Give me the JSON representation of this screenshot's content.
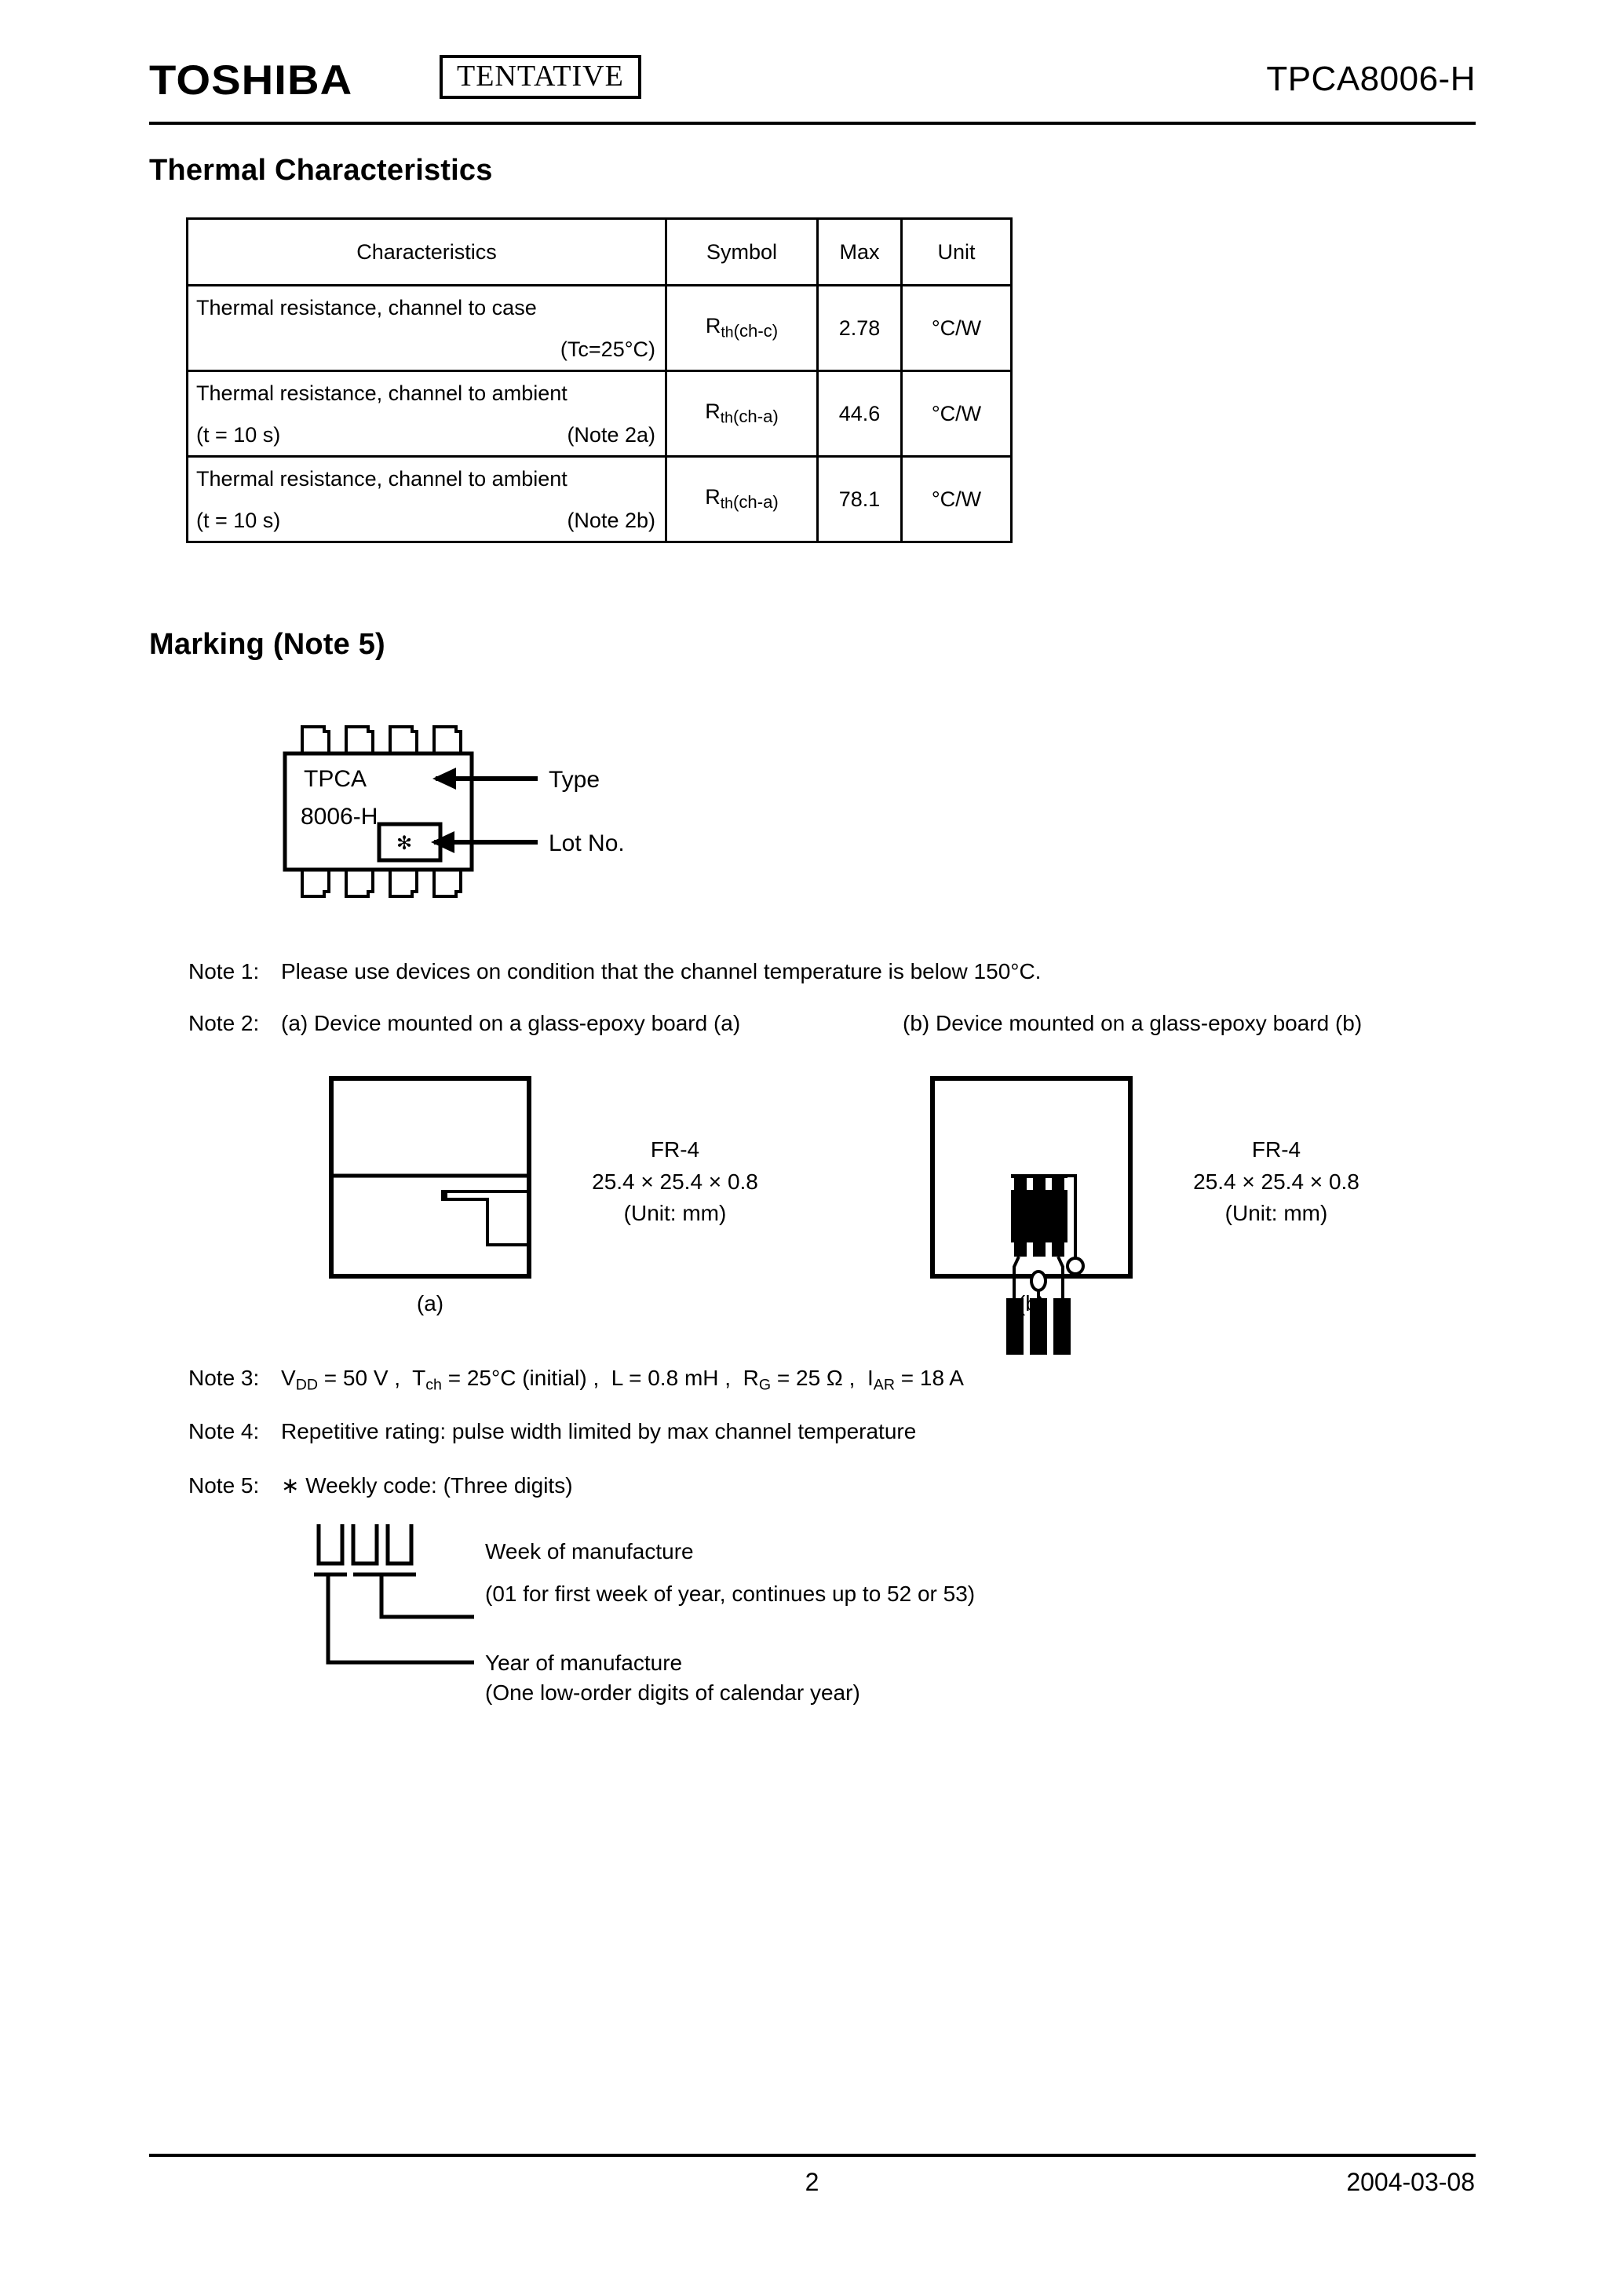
{
  "header": {
    "brand": "TOSHIBA",
    "tentative": "TENTATIVE",
    "part_number": "TPCA8006-H"
  },
  "thermal_section": {
    "heading": "Thermal Characteristics",
    "table": {
      "columns": [
        "Characteristics",
        "Symbol",
        "Max",
        "Unit"
      ],
      "rows": [
        {
          "characteristic_main": "Thermal resistance, channel to case",
          "characteristic_left": "",
          "characteristic_right": "(Tc=25°C)",
          "symbol_base": "R",
          "symbol_sub": "th",
          "symbol_paren": "(ch-c)",
          "max": "2.78",
          "unit": "°C/W"
        },
        {
          "characteristic_main": "Thermal resistance, channel to ambient",
          "characteristic_left": "(t = 10 s)",
          "characteristic_right": "(Note 2a)",
          "symbol_base": "R",
          "symbol_sub": "th",
          "symbol_paren": "(ch-a)",
          "max": "44.6",
          "unit": "°C/W"
        },
        {
          "characteristic_main": "Thermal resistance, channel to ambient",
          "characteristic_left": "(t = 10 s)",
          "characteristic_right": "(Note 2b)",
          "symbol_base": "R",
          "symbol_sub": "th",
          "symbol_paren": "(ch-a)",
          "max": "78.1",
          "unit": "°C/W"
        }
      ]
    }
  },
  "marking_section": {
    "heading_main": "Marking",
    "heading_note": "(Note 5)",
    "package": {
      "line1": "TPCA",
      "line2": "8006-H",
      "lot_glyph": "✻"
    },
    "callout_type": "Type",
    "callout_lot": "Lot No."
  },
  "notes": {
    "note1": {
      "label": "Note 1:",
      "text": "Please use devices on condition that the channel temperature is below 150°C."
    },
    "note2": {
      "label": "Note 2:",
      "text_a": "(a) Device mounted on a glass-epoxy board (a)",
      "text_b": "(b) Device mounted on a glass-epoxy board (b)"
    },
    "note3": {
      "label": "Note 3:",
      "items": [
        {
          "sym": "V",
          "sub": "DD",
          "val": "= 50 V ,"
        },
        {
          "sym": "T",
          "sub": "ch",
          "val": "= 25°C (initial) ,"
        },
        {
          "sym": "L",
          "sub": "",
          "val": "= 0.8 mH ,"
        },
        {
          "sym": "R",
          "sub": "G",
          "val": "= 25 Ω ,"
        },
        {
          "sym": "I",
          "sub": "AR",
          "val": "= 18 A"
        }
      ]
    },
    "note4": {
      "label": "Note 4:",
      "text": "Repetitive rating: pulse width limited by max channel temperature"
    },
    "note5": {
      "label": "Note 5:",
      "text": "∗ Weekly code: (Three digits)"
    }
  },
  "board_figures": [
    {
      "caption": "(a)",
      "material": "FR-4",
      "dimensions": "25.4 × 25.4 × 0.8",
      "unit_note": "(Unit: mm)"
    },
    {
      "caption": "(b)",
      "material": "FR-4",
      "dimensions": "25.4 × 25.4 × 0.8",
      "unit_note": "(Unit: mm)"
    }
  ],
  "weekly_code": {
    "week_title": "Week of manufacture",
    "week_detail": "(01 for first week of year, continues up to 52 or 53)",
    "year_title": "Year of manufacture",
    "year_detail": "(One low-order digits of calendar year)"
  },
  "footer": {
    "page_number": "2",
    "date": "2004-03-08"
  }
}
